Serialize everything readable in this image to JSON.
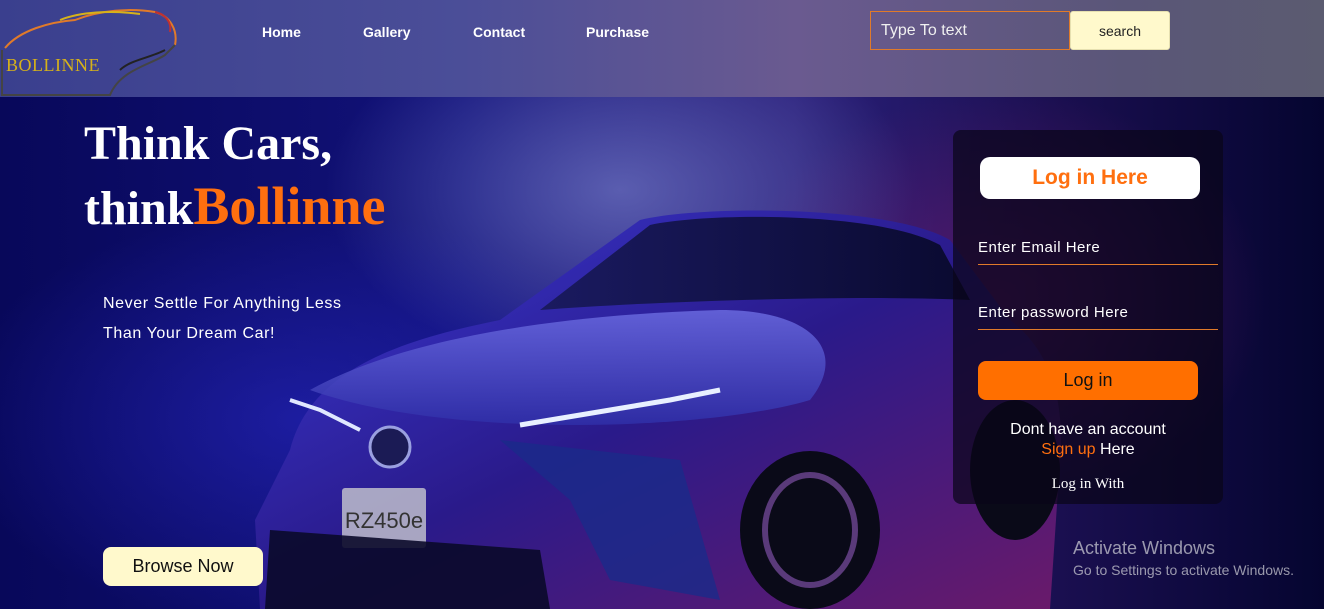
{
  "brand": {
    "logo_text": "BOLLINNE"
  },
  "nav": {
    "items": [
      {
        "label": "Home"
      },
      {
        "label": "Gallery"
      },
      {
        "label": "Contact"
      },
      {
        "label": "Purchase"
      }
    ]
  },
  "search": {
    "placeholder": "Type To text",
    "button_label": "search"
  },
  "hero": {
    "line1": "Think Cars,",
    "line2_prefix": "think",
    "line2_brand": "Bollinne",
    "tagline_1": "Never Settle For Anything Less",
    "tagline_2": "Than Your Dream Car!",
    "browse_label": "Browse Now",
    "plate": "RZ450e"
  },
  "login": {
    "title": "Log in Here",
    "email_placeholder": "Enter Email Here",
    "password_placeholder": "Enter password Here",
    "button_label": "Log in",
    "no_account": "Dont have an account",
    "signup_link": "Sign up",
    "signup_suffix": " Here",
    "login_with": "Log in With"
  },
  "watermark": {
    "title": "Activate Windows",
    "subtitle": "Go to Settings to activate Windows."
  },
  "colors": {
    "accent": "#ff6f0f",
    "button_cream": "#fff9cc",
    "logo_gold": "#d6b21a"
  },
  "icons": [
    "car-logo-icon"
  ]
}
